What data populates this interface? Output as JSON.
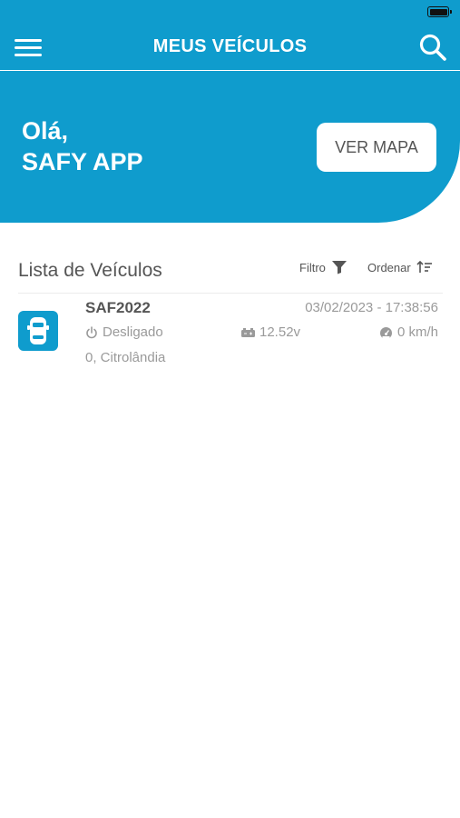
{
  "colors": {
    "primary": "#0f9ccd",
    "text_dark": "#555555",
    "text_muted": "#9a9a9a"
  },
  "header": {
    "title": "MEUS VEÍCULOS",
    "menu_icon": "hamburger-menu-icon",
    "search_icon": "search-icon"
  },
  "hero": {
    "greeting_line1": "Olá,",
    "greeting_line2": "SAFY APP",
    "map_button_label": "VER MAPA"
  },
  "list": {
    "title": "Lista de Veículos",
    "filter_label": "Filtro",
    "filter_icon": "funnel-icon",
    "sort_label": "Ordenar",
    "sort_icon": "sort-icon",
    "vehicles": [
      {
        "plate": "SAF2022",
        "datetime": "03/02/2023 - 17:38:56",
        "status": "Desligado",
        "voltage": "12.52v",
        "speed": "0 km/h",
        "address": "0, Citrolândia",
        "icon": "car-icon"
      }
    ]
  }
}
